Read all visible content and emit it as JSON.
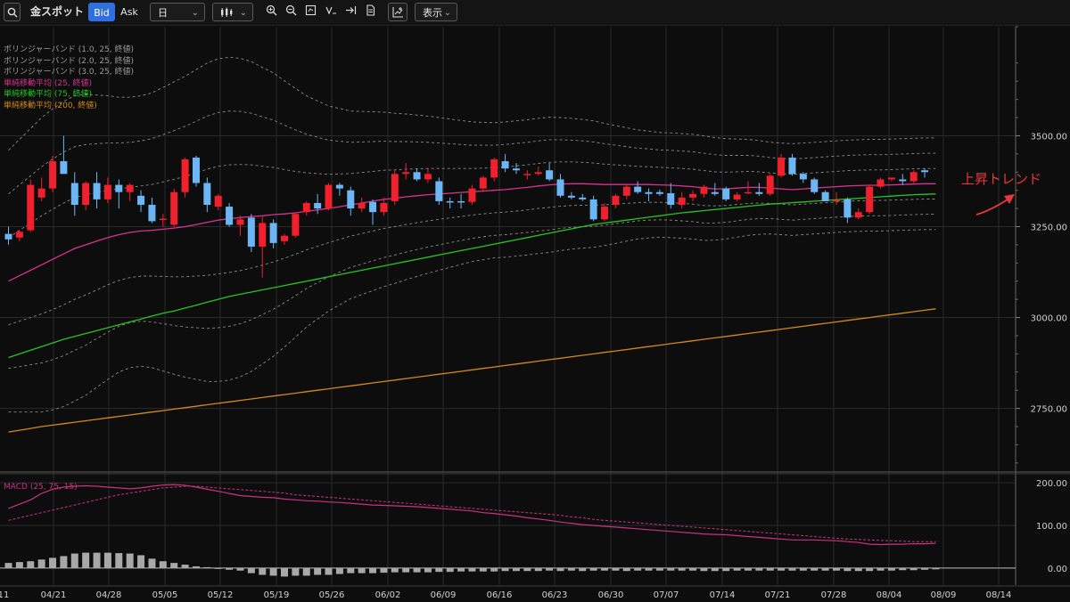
{
  "toolbar": {
    "symbol": "金スポット",
    "bid_label": "Bid",
    "ask_label": "Ask",
    "period": "日",
    "chart_type_icon": "candlestick-icon",
    "display_label": "表示",
    "icons": [
      "zoom-in-icon",
      "zoom-out-icon",
      "fit-screen-icon",
      "indicator-icon",
      "jump-latest-icon",
      "document-icon",
      "add-chart-icon"
    ]
  },
  "legend": [
    {
      "text": "ボリンジャーバンド (1.0, 25, 終値)",
      "color": "#9a9a9a"
    },
    {
      "text": "ボリンジャーバンド (2.0, 25, 終値)",
      "color": "#9a9a9a"
    },
    {
      "text": "ボリンジャーバンド (3.0, 25, 終値)",
      "color": "#9a9a9a"
    },
    {
      "text": "単純移動平均 (25, 終値)",
      "color": "#d6338f"
    },
    {
      "text": "単純移動平均 (75, 終値)",
      "color": "#27c427"
    },
    {
      "text": "単純移動平均 (200, 終値)",
      "color": "#d08a1b"
    }
  ],
  "macd_legend": "MACD (25, 75, 15)",
  "annotation": "上昇トレンド",
  "colors": {
    "up": "#f0202c",
    "down": "#6cb6f5",
    "sma25": "#d6338f",
    "sma75": "#27c427",
    "sma200": "#d08a1b",
    "bb": "#8a8a8a",
    "macd": "#c8337f",
    "hist": "#a8a8a8",
    "grid": "#2a2a2a",
    "axis_text": "#d0d0d0"
  },
  "chart_data": {
    "type": "candlestick",
    "y_ticks": [
      3500,
      3250,
      3000,
      2750
    ],
    "ylim": [
      2580,
      3800
    ],
    "x_ticks": [
      "04/21",
      "04/28",
      "05/05",
      "05/12",
      "05/19",
      "05/26",
      "06/02",
      "06/09",
      "06/16",
      "06/23",
      "06/30",
      "07/07",
      "07/14",
      "07/21",
      "07/28",
      "08/04",
      "08/09",
      "08/14"
    ],
    "x_tick_partial_left": "11",
    "candles": [
      {
        "o": 3230,
        "h": 3250,
        "l": 3200,
        "c": 3215
      },
      {
        "o": 3220,
        "h": 3240,
        "l": 3210,
        "c": 3236
      },
      {
        "o": 3240,
        "h": 3380,
        "l": 3235,
        "c": 3365
      },
      {
        "o": 3330,
        "h": 3385,
        "l": 3320,
        "c": 3355
      },
      {
        "o": 3355,
        "h": 3445,
        "l": 3345,
        "c": 3430
      },
      {
        "o": 3430,
        "h": 3500,
        "l": 3420,
        "c": 3395
      },
      {
        "o": 3370,
        "h": 3400,
        "l": 3280,
        "c": 3310
      },
      {
        "o": 3310,
        "h": 3375,
        "l": 3295,
        "c": 3370
      },
      {
        "o": 3370,
        "h": 3400,
        "l": 3300,
        "c": 3325
      },
      {
        "o": 3325,
        "h": 3385,
        "l": 3315,
        "c": 3365
      },
      {
        "o": 3365,
        "h": 3380,
        "l": 3300,
        "c": 3345
      },
      {
        "o": 3345,
        "h": 3370,
        "l": 3320,
        "c": 3365
      },
      {
        "o": 3335,
        "h": 3350,
        "l": 3290,
        "c": 3310
      },
      {
        "o": 3310,
        "h": 3330,
        "l": 3260,
        "c": 3265
      },
      {
        "o": 3270,
        "h": 3285,
        "l": 3250,
        "c": 3272
      },
      {
        "o": 3255,
        "h": 3355,
        "l": 3250,
        "c": 3345
      },
      {
        "o": 3345,
        "h": 3440,
        "l": 3330,
        "c": 3435
      },
      {
        "o": 3440,
        "h": 3445,
        "l": 3360,
        "c": 3370
      },
      {
        "o": 3370,
        "h": 3385,
        "l": 3290,
        "c": 3310
      },
      {
        "o": 3305,
        "h": 3340,
        "l": 3295,
        "c": 3335
      },
      {
        "o": 3305,
        "h": 3315,
        "l": 3250,
        "c": 3255
      },
      {
        "o": 3255,
        "h": 3280,
        "l": 3225,
        "c": 3270
      },
      {
        "o": 3275,
        "h": 3285,
        "l": 3180,
        "c": 3195
      },
      {
        "o": 3195,
        "h": 3280,
        "l": 3110,
        "c": 3260
      },
      {
        "o": 3260,
        "h": 3270,
        "l": 3190,
        "c": 3205
      },
      {
        "o": 3210,
        "h": 3230,
        "l": 3200,
        "c": 3225
      },
      {
        "o": 3225,
        "h": 3290,
        "l": 3220,
        "c": 3285
      },
      {
        "o": 3290,
        "h": 3320,
        "l": 3280,
        "c": 3315
      },
      {
        "o": 3315,
        "h": 3340,
        "l": 3285,
        "c": 3300
      },
      {
        "o": 3300,
        "h": 3370,
        "l": 3295,
        "c": 3365
      },
      {
        "o": 3365,
        "h": 3370,
        "l": 3335,
        "c": 3355
      },
      {
        "o": 3350,
        "h": 3360,
        "l": 3280,
        "c": 3300
      },
      {
        "o": 3300,
        "h": 3330,
        "l": 3290,
        "c": 3315
      },
      {
        "o": 3318,
        "h": 3325,
        "l": 3255,
        "c": 3290
      },
      {
        "o": 3290,
        "h": 3330,
        "l": 3280,
        "c": 3315
      },
      {
        "o": 3320,
        "h": 3405,
        "l": 3310,
        "c": 3395
      },
      {
        "o": 3395,
        "h": 3425,
        "l": 3380,
        "c": 3400
      },
      {
        "o": 3400,
        "h": 3410,
        "l": 3375,
        "c": 3380
      },
      {
        "o": 3380,
        "h": 3410,
        "l": 3370,
        "c": 3395
      },
      {
        "o": 3375,
        "h": 3385,
        "l": 3310,
        "c": 3320
      },
      {
        "o": 3320,
        "h": 3330,
        "l": 3300,
        "c": 3318
      },
      {
        "o": 3320,
        "h": 3340,
        "l": 3300,
        "c": 3318
      },
      {
        "o": 3318,
        "h": 3365,
        "l": 3310,
        "c": 3355
      },
      {
        "o": 3355,
        "h": 3390,
        "l": 3345,
        "c": 3385
      },
      {
        "o": 3385,
        "h": 3440,
        "l": 3375,
        "c": 3435
      },
      {
        "o": 3430,
        "h": 3450,
        "l": 3400,
        "c": 3410
      },
      {
        "o": 3410,
        "h": 3425,
        "l": 3395,
        "c": 3405
      },
      {
        "o": 3395,
        "h": 3405,
        "l": 3380,
        "c": 3395
      },
      {
        "o": 3395,
        "h": 3415,
        "l": 3390,
        "c": 3400
      },
      {
        "o": 3405,
        "h": 3425,
        "l": 3375,
        "c": 3380
      },
      {
        "o": 3380,
        "h": 3395,
        "l": 3330,
        "c": 3335
      },
      {
        "o": 3335,
        "h": 3345,
        "l": 3325,
        "c": 3330
      },
      {
        "o": 3330,
        "h": 3340,
        "l": 3320,
        "c": 3325
      },
      {
        "o": 3325,
        "h": 3335,
        "l": 3265,
        "c": 3270
      },
      {
        "o": 3270,
        "h": 3315,
        "l": 3265,
        "c": 3305
      },
      {
        "o": 3310,
        "h": 3340,
        "l": 3300,
        "c": 3335
      },
      {
        "o": 3335,
        "h": 3365,
        "l": 3325,
        "c": 3360
      },
      {
        "o": 3360,
        "h": 3375,
        "l": 3340,
        "c": 3345
      },
      {
        "o": 3345,
        "h": 3355,
        "l": 3320,
        "c": 3340
      },
      {
        "o": 3345,
        "h": 3352,
        "l": 3335,
        "c": 3340
      },
      {
        "o": 3342,
        "h": 3370,
        "l": 3300,
        "c": 3310
      },
      {
        "o": 3310,
        "h": 3345,
        "l": 3300,
        "c": 3330
      },
      {
        "o": 3330,
        "h": 3350,
        "l": 3320,
        "c": 3340
      },
      {
        "o": 3340,
        "h": 3365,
        "l": 3330,
        "c": 3360
      },
      {
        "o": 3345,
        "h": 3370,
        "l": 3335,
        "c": 3340
      },
      {
        "o": 3355,
        "h": 3360,
        "l": 3320,
        "c": 3325
      },
      {
        "o": 3325,
        "h": 3345,
        "l": 3320,
        "c": 3338
      },
      {
        "o": 3345,
        "h": 3375,
        "l": 3340,
        "c": 3345
      },
      {
        "o": 3345,
        "h": 3370,
        "l": 3335,
        "c": 3340
      },
      {
        "o": 3340,
        "h": 3395,
        "l": 3335,
        "c": 3390
      },
      {
        "o": 3390,
        "h": 3450,
        "l": 3385,
        "c": 3440
      },
      {
        "o": 3440,
        "h": 3450,
        "l": 3390,
        "c": 3395
      },
      {
        "o": 3395,
        "h": 3400,
        "l": 3370,
        "c": 3380
      },
      {
        "o": 3380,
        "h": 3385,
        "l": 3340,
        "c": 3345
      },
      {
        "o": 3345,
        "h": 3350,
        "l": 3320,
        "c": 3320
      },
      {
        "o": 3320,
        "h": 3345,
        "l": 3310,
        "c": 3323
      },
      {
        "o": 3325,
        "h": 3330,
        "l": 3260,
        "c": 3275
      },
      {
        "o": 3275,
        "h": 3300,
        "l": 3270,
        "c": 3290
      },
      {
        "o": 3290,
        "h": 3365,
        "l": 3285,
        "c": 3360
      },
      {
        "o": 3360,
        "h": 3385,
        "l": 3355,
        "c": 3380
      },
      {
        "o": 3380,
        "h": 3385,
        "l": 3375,
        "c": 3385
      },
      {
        "o": 3380,
        "h": 3395,
        "l": 3365,
        "c": 3375
      },
      {
        "o": 3375,
        "h": 3405,
        "l": 3370,
        "c": 3400
      },
      {
        "o": 3405,
        "h": 3410,
        "l": 3385,
        "c": 3400
      }
    ],
    "sma25": [
      3100,
      3115,
      3130,
      3145,
      3160,
      3175,
      3190,
      3200,
      3210,
      3220,
      3228,
      3234,
      3238,
      3240,
      3243,
      3246,
      3250,
      3256,
      3262,
      3268,
      3272,
      3275,
      3278,
      3280,
      3283,
      3285,
      3288,
      3292,
      3296,
      3300,
      3305,
      3310,
      3315,
      3320,
      3325,
      3328,
      3332,
      3335,
      3338,
      3340,
      3342,
      3344,
      3346,
      3348,
      3350,
      3352,
      3355,
      3358,
      3362,
      3365,
      3367,
      3368,
      3368,
      3367,
      3366,
      3366,
      3366,
      3366,
      3366,
      3365,
      3364,
      3362,
      3360,
      3356,
      3354,
      3354,
      3356,
      3358,
      3358,
      3356,
      3354,
      3352,
      3354,
      3356,
      3358,
      3360,
      3362,
      3363,
      3364,
      3364,
      3365,
      3366,
      3367,
      3368,
      3368
    ],
    "sma75": [
      2890,
      2900,
      2910,
      2920,
      2930,
      2940,
      2948,
      2956,
      2964,
      2972,
      2980,
      2988,
      2996,
      3004,
      3012,
      3018,
      3026,
      3034,
      3042,
      3050,
      3058,
      3064,
      3070,
      3076,
      3082,
      3088,
      3094,
      3100,
      3106,
      3112,
      3118,
      3124,
      3130,
      3136,
      3142,
      3148,
      3154,
      3160,
      3166,
      3172,
      3178,
      3184,
      3190,
      3196,
      3202,
      3208,
      3214,
      3220,
      3226,
      3232,
      3238,
      3244,
      3250,
      3256,
      3260,
      3264,
      3268,
      3272,
      3276,
      3280,
      3284,
      3288,
      3291,
      3294,
      3297,
      3300,
      3303,
      3306,
      3309,
      3312,
      3314,
      3316,
      3318,
      3320,
      3322,
      3324,
      3326,
      3328,
      3330,
      3332,
      3334,
      3336,
      3338,
      3339,
      3340
    ],
    "sma200": [
      2685,
      2690,
      2695,
      2700,
      2704,
      2708,
      2712,
      2716,
      2720,
      2724,
      2728,
      2732,
      2736,
      2740,
      2744,
      2748,
      2752,
      2756,
      2760,
      2764,
      2768,
      2772,
      2776,
      2780,
      2784,
      2788,
      2792,
      2796,
      2800,
      2804,
      2808,
      2812,
      2816,
      2820,
      2824,
      2828,
      2832,
      2836,
      2840,
      2844,
      2848,
      2852,
      2856,
      2860,
      2864,
      2868,
      2872,
      2876,
      2880,
      2884,
      2888,
      2892,
      2896,
      2900,
      2904,
      2908,
      2912,
      2916,
      2920,
      2924,
      2928,
      2932,
      2936,
      2940,
      2944,
      2948,
      2952,
      2956,
      2960,
      2964,
      2968,
      2972,
      2976,
      2980,
      2984,
      2988,
      2992,
      2996,
      3000,
      3004,
      3008,
      3012,
      3016,
      3020,
      3024
    ],
    "bb_sigma": [
      120,
      125,
      130,
      135,
      138,
      140,
      140,
      138,
      134,
      130,
      126,
      124,
      124,
      126,
      130,
      134,
      138,
      142,
      146,
      148,
      148,
      146,
      142,
      136,
      130,
      122,
      114,
      106,
      100,
      94,
      90,
      86,
      84,
      82,
      80,
      78,
      76,
      74,
      72,
      70,
      68,
      66,
      64,
      63,
      62,
      62,
      62,
      62,
      62,
      62,
      61,
      60,
      59,
      58,
      56,
      54,
      52,
      50,
      49,
      48,
      48,
      48,
      48,
      48,
      47,
      46,
      45,
      44,
      43,
      42,
      42,
      42,
      42,
      42,
      42,
      42,
      42,
      42,
      42,
      42,
      42,
      42,
      42,
      42,
      42
    ],
    "macd_ylim": [
      -40,
      215
    ],
    "macd_ticks": [
      200,
      100,
      0
    ],
    "macd_line": [
      140,
      150,
      160,
      175,
      185,
      190,
      192,
      193,
      192,
      190,
      188,
      186,
      188,
      192,
      195,
      196,
      194,
      190,
      185,
      180,
      175,
      170,
      168,
      166,
      165,
      162,
      160,
      158,
      157,
      155,
      154,
      152,
      150,
      148,
      147,
      146,
      145,
      144,
      142,
      140,
      138,
      136,
      134,
      130,
      128,
      125,
      122,
      118,
      115,
      112,
      108,
      105,
      102,
      100,
      98,
      96,
      94,
      92,
      90,
      88,
      86,
      84,
      82,
      80,
      79,
      78,
      76,
      74,
      72,
      70,
      68,
      66,
      66,
      66,
      65,
      64,
      62,
      60,
      56,
      55,
      56,
      56,
      57,
      57,
      58
    ],
    "macd_signal": [
      112,
      118,
      124,
      130,
      136,
      142,
      148,
      154,
      160,
      166,
      172,
      176,
      180,
      184,
      188,
      190,
      192,
      192,
      190,
      188,
      186,
      184,
      182,
      180,
      178,
      176,
      172,
      170,
      168,
      166,
      164,
      162,
      160,
      158,
      156,
      154,
      152,
      150,
      148,
      146,
      144,
      142,
      140,
      138,
      136,
      134,
      132,
      130,
      128,
      126,
      124,
      120,
      118,
      114,
      112,
      110,
      108,
      106,
      104,
      102,
      100,
      98,
      96,
      94,
      92,
      90,
      88,
      86,
      84,
      82,
      80,
      78,
      76,
      74,
      72,
      70,
      68,
      67,
      66,
      65,
      64,
      63,
      62,
      62,
      62
    ],
    "macd_hist": [
      12,
      14,
      16,
      20,
      24,
      28,
      34,
      36,
      36,
      36,
      35,
      34,
      30,
      22,
      16,
      12,
      8,
      4,
      2,
      0,
      -4,
      -6,
      -12,
      -16,
      -18,
      -20,
      -18,
      -18,
      -16,
      -16,
      -14,
      -12,
      -12,
      -12,
      -11,
      -10,
      -10,
      -10,
      -10,
      -9,
      -9,
      -8,
      -8,
      -8,
      -8,
      -7,
      -7,
      -7,
      -7,
      -6,
      -7,
      -6,
      -7,
      -6,
      -6,
      -6,
      -7,
      -6,
      -6,
      -6,
      -6,
      -6,
      -6,
      -7,
      -7,
      -7,
      -6,
      -6,
      -6,
      -6,
      -6,
      -6,
      -6,
      -6,
      -6,
      -6,
      -7,
      -7,
      -7,
      -6,
      -6,
      -5,
      -5,
      -4,
      -3
    ]
  }
}
